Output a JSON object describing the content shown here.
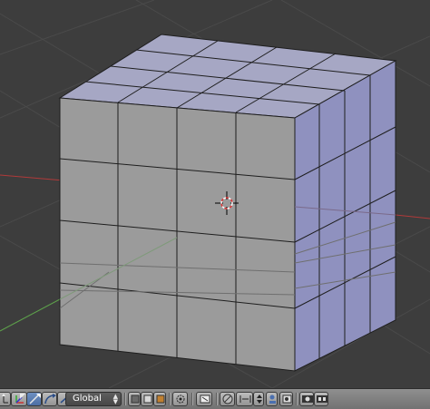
{
  "viewport": {
    "object": "cube",
    "cursor_icon": "3d-cursor-icon",
    "axis_colors": {
      "x": "#b03a3a",
      "y": "#5da04b"
    },
    "face_colors": {
      "front": "#9b9b9b",
      "top": "#a6a7c4",
      "side": "#8f91bf"
    }
  },
  "header": {
    "transform_orientation": {
      "selected": "Global"
    },
    "icons": [
      "manipulator-toggle-icon",
      "translate-manipulator-icon",
      "rotate-manipulator-icon",
      "scale-manipulator-icon",
      "layer-solid-icon",
      "layer-wire-icon",
      "layer-box-icon",
      "pivot-point-icon",
      "snap-icon",
      "snap-element-icon",
      "proportional-edit-icon",
      "render-icon",
      "render-animation-icon"
    ]
  }
}
